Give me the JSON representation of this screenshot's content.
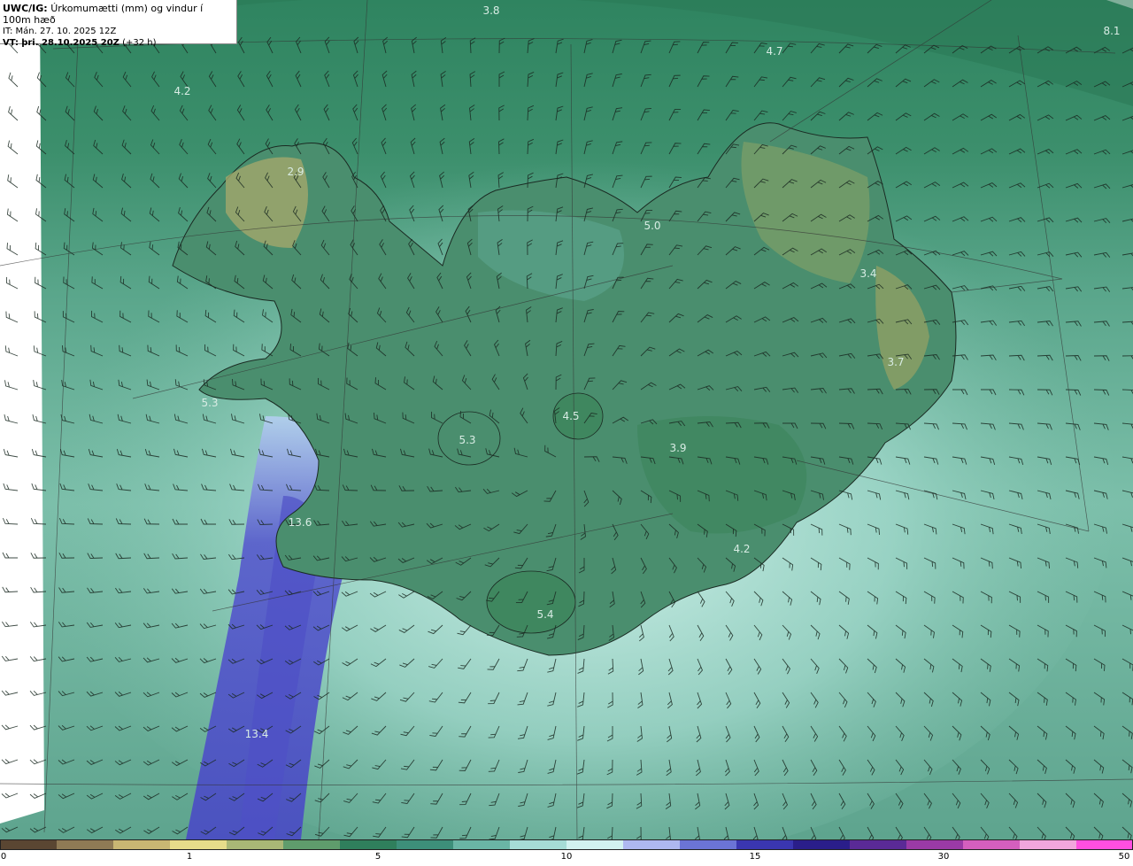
{
  "header": {
    "model": "UWC/IG:",
    "field": "Úrkomumætti (mm) og vindur í 100m hæð",
    "init_time": "IT: Mán. 27. 10. 2025 12Z",
    "valid_prefix": "VT:",
    "valid_time": "þri. 28.10.2025 20Z",
    "lead_time": "(+32 h)"
  },
  "value_labels": [
    {
      "text": "3.8"
    },
    {
      "text": "4.7"
    },
    {
      "text": "8.1"
    },
    {
      "text": "4.2"
    },
    {
      "text": "2.9"
    },
    {
      "text": "5.0"
    },
    {
      "text": "3.4"
    },
    {
      "text": "3.7"
    },
    {
      "text": "5.3"
    },
    {
      "text": "4.5"
    },
    {
      "text": "5.3"
    },
    {
      "text": "3.9"
    },
    {
      "text": "13.6"
    },
    {
      "text": "4.2"
    },
    {
      "text": "5.4"
    },
    {
      "text": "13.4"
    }
  ],
  "colorbar": {
    "ticks": [
      "0",
      "1",
      "5",
      "10",
      "15",
      "30",
      "50"
    ],
    "colors": [
      "#5a4632",
      "#8f7a55",
      "#c9b673",
      "#e6dc8a",
      "#a9b776",
      "#5f9c6c",
      "#2f7f5c",
      "#3d8f7a",
      "#6ab5a5",
      "#a6dcd6",
      "#d2f2f0",
      "#aeb8f0",
      "#6b74d6",
      "#3a36b0",
      "#2a1e8a",
      "#5a2a96",
      "#9a3aa6",
      "#d45fbe",
      "#f1a6dd",
      "#ff4fe0"
    ]
  }
}
